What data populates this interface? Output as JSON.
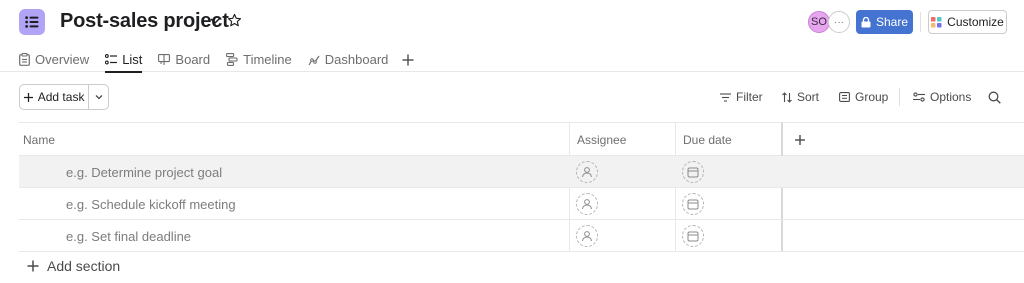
{
  "project": {
    "title": "Post-sales project",
    "icon": "list-icon",
    "icon_color": "#b1a4f7"
  },
  "header": {
    "avatar_initials": "SO",
    "more_members": "···",
    "share_label": "Share",
    "customize_label": "Customize",
    "share_color": "#4573d2"
  },
  "tabs": [
    {
      "label": "Overview",
      "icon": "clipboard-icon"
    },
    {
      "label": "List",
      "icon": "list-check-icon",
      "active": true
    },
    {
      "label": "Board",
      "icon": "board-icon"
    },
    {
      "label": "Timeline",
      "icon": "timeline-icon"
    },
    {
      "label": "Dashboard",
      "icon": "dashboard-icon"
    }
  ],
  "toolbar": {
    "add_task_label": "Add task",
    "filter_label": "Filter",
    "sort_label": "Sort",
    "group_label": "Group",
    "options_label": "Options"
  },
  "table": {
    "columns": [
      "Name",
      "Assignee",
      "Due date"
    ],
    "rows": [
      {
        "placeholder": "e.g. Determine project goal"
      },
      {
        "placeholder": "e.g. Schedule kickoff meeting"
      },
      {
        "placeholder": "e.g. Set final deadline"
      }
    ]
  },
  "add_section_label": "Add section"
}
